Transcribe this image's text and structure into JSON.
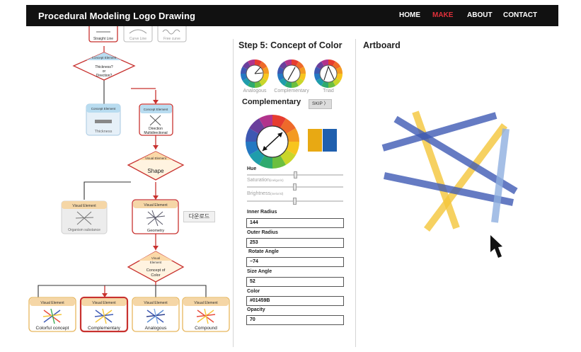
{
  "header": {
    "title": "Procedural Modeling Logo Drawing",
    "nav": [
      "HOME",
      "MAKE",
      "ABOUT",
      "CONTACT"
    ],
    "active_nav": "MAKE",
    "active_color": "#e0303a"
  },
  "flow": {
    "top_row": [
      "Straight Line",
      "Curve Line",
      "Free curve"
    ],
    "concept_element": "Concept Element",
    "visual_element": "Visual Element",
    "diamond1": "Thickness? or Direction?",
    "thickness": "Thickness",
    "direction": "Direction Multidirectional",
    "shape": "Shape",
    "organism": "Organism substance",
    "geometry": "Geometry",
    "concept_of_color": "Concept of Color",
    "bottom_row": [
      "Colorful concept",
      "Complementary",
      "Analogous",
      "Compound"
    ],
    "tooltip": "다운로드"
  },
  "panel": {
    "step_title": "Step 5: Concept of Color",
    "schemes": [
      "Analogous",
      "Complementary",
      "Triad"
    ],
    "mode_title": "Complementary",
    "skip_label": "SKIP 〉",
    "swatches": [
      "#E8A913",
      "#1F5FAE"
    ],
    "sliders": {
      "hue": {
        "label": "Hue",
        "value": 0.5
      },
      "saturation": {
        "label": "Saturation",
        "sub": "(inelgoris)",
        "value": 0.49
      },
      "brightness": {
        "label": "Brightness",
        "sub": "(inelorisl)",
        "value": 0.49
      }
    },
    "fields": [
      {
        "label": "Inner Radius",
        "value": "144"
      },
      {
        "label": "Outer Radius",
        "value": "253"
      },
      {
        "label": "Rotate Angle",
        "value": "−74"
      },
      {
        "label": "Size Angle",
        "value": "52"
      },
      {
        "label": "Color",
        "value": "#01459B"
      },
      {
        "label": "Opacity",
        "value": "70"
      }
    ]
  },
  "artboard": {
    "title": "Artboard",
    "colors": {
      "blue": "#3f5bb5",
      "yellow": "#f5c63a",
      "light_blue": "#8fb0e0"
    }
  }
}
